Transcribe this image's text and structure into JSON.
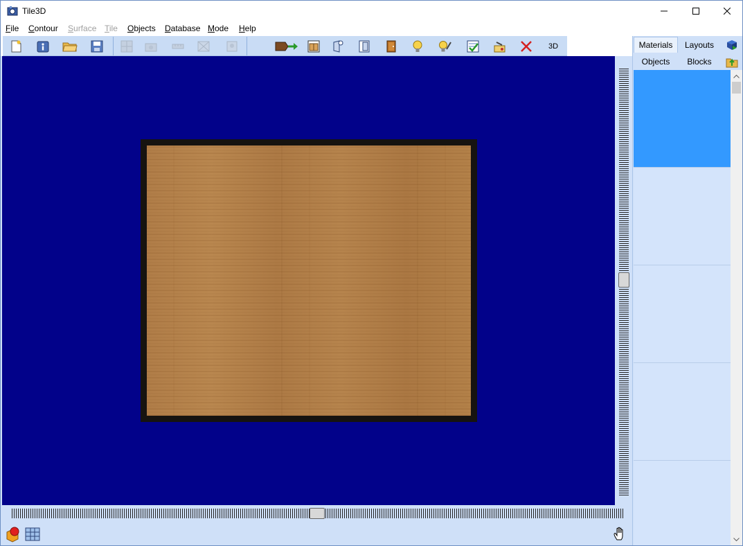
{
  "window": {
    "title": "Tile3D"
  },
  "menu": {
    "file": {
      "first": "F",
      "rest": "ile"
    },
    "contour": {
      "first": "C",
      "rest": "ontour"
    },
    "surface": {
      "first": "S",
      "rest": "urface"
    },
    "tile": {
      "first": "T",
      "rest": "ile"
    },
    "objects": {
      "first": "O",
      "rest": "bjects"
    },
    "database": {
      "first": "D",
      "rest": "atabase"
    },
    "mode": {
      "first": "M",
      "rest": "ode"
    },
    "help": {
      "first": "H",
      "rest": "elp"
    }
  },
  "toolbar": {
    "mode_3d_label": "3D"
  },
  "panel": {
    "tabs": {
      "materials": "Materials",
      "layouts": "Layouts",
      "objects": "Objects",
      "blocks": "Blocks"
    },
    "selected_row": 0
  },
  "colors": {
    "canvas_bg": "#02028a",
    "accent": "#3399ff",
    "chrome": "#cfe0f8"
  },
  "icons": [
    "new-document-icon",
    "info-icon",
    "open-folder-icon",
    "save-icon",
    "grid-icon",
    "camera-icon",
    "ruler-icon",
    "cut-icon",
    "image-icon",
    "import-arrow-icon",
    "door-window-icon",
    "door-add-icon",
    "door-open-icon",
    "door-icon",
    "lightbulb-icon",
    "lightbulb-paint-icon",
    "checklist-icon",
    "report-icon",
    "delete-icon",
    "cube-icon",
    "tile-grid-icon",
    "hand-cursor-icon"
  ]
}
